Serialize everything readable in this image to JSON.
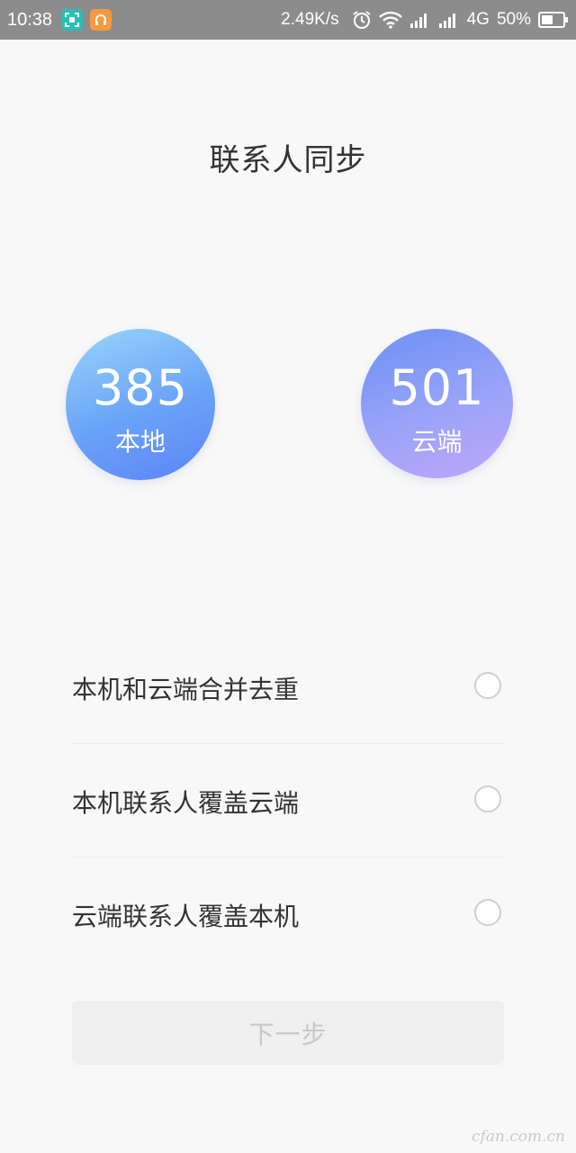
{
  "status_bar": {
    "time": "10:38",
    "net_speed": "2.49K/s",
    "network_type": "4G",
    "battery": "50%",
    "icons": [
      "screenshot-app-icon",
      "headset-app-icon",
      "alarm-icon",
      "wifi-icon",
      "signal-icon",
      "signal-4g-icon",
      "battery-icon"
    ]
  },
  "page": {
    "title": "联系人同步"
  },
  "stats": {
    "local": {
      "count": "385",
      "label": "本地"
    },
    "cloud": {
      "count": "501",
      "label": "云端"
    }
  },
  "options": [
    {
      "label": "本机和云端合并去重",
      "selected": false
    },
    {
      "label": "本机联系人覆盖云端",
      "selected": false
    },
    {
      "label": "云端联系人覆盖本机",
      "selected": false
    }
  ],
  "next_button": {
    "label": "下一步",
    "enabled": false
  },
  "watermark": "cfan.com.cn",
  "colors": {
    "status_bar": "#8c8c8c",
    "background": "#f8f8f8",
    "local_circle": "#6aa2f8",
    "cloud_circle": "#a0a2f8"
  }
}
